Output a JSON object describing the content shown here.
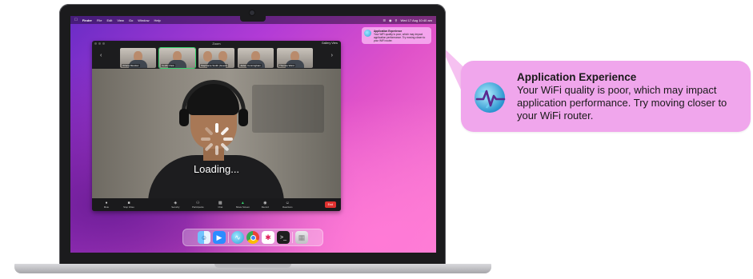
{
  "menubar": {
    "app_name": "Finder",
    "items": [
      "File",
      "Edit",
      "View",
      "Go",
      "Window",
      "Help"
    ],
    "clock": "Wed 17 Aug 10:40 am"
  },
  "zoom": {
    "window_title": "Zoom",
    "gallery_view_label": "Gallery View",
    "participants": [
      {
        "name": "Oriana Mendez"
      },
      {
        "name": "Cedric Park",
        "active": true
      },
      {
        "name": "Stephanie Smith (Guest)"
      },
      {
        "name": "Jaden Cunningham"
      },
      {
        "name": "Thomas Ward"
      }
    ],
    "loading_text": "Loading...",
    "toolbar": {
      "mute": "Mute",
      "stop_video": "Stop Video",
      "security": "Security",
      "participants": "Participants",
      "chat": "Chat",
      "share_screen": "Share Screen",
      "record": "Record",
      "reactions": "Reactions",
      "end": "End"
    }
  },
  "mini_notification": {
    "title": "Application Experience",
    "body": "Your WiFi quality is poor, which may impact application performance. Try moving closer to your WiFi router."
  },
  "notification": {
    "title": "Application Experience",
    "body": "Your WiFi quality is poor, which may impact application performance. Try moving closer to your WiFi router.",
    "icon": "globe-wifi-pulse-icon"
  },
  "dock": {
    "apps": [
      "finder-icon",
      "zoom-icon",
      "network-monitor-icon",
      "chrome-icon",
      "slack-icon",
      "terminal-icon",
      "trash-icon"
    ]
  },
  "colors": {
    "wallpaper_start": "#6a2cc6",
    "wallpaper_end": "#ff86d5",
    "callout_bg": "#f0a6ec",
    "end_button": "#e0312f",
    "active_speaker": "#35d06b"
  }
}
